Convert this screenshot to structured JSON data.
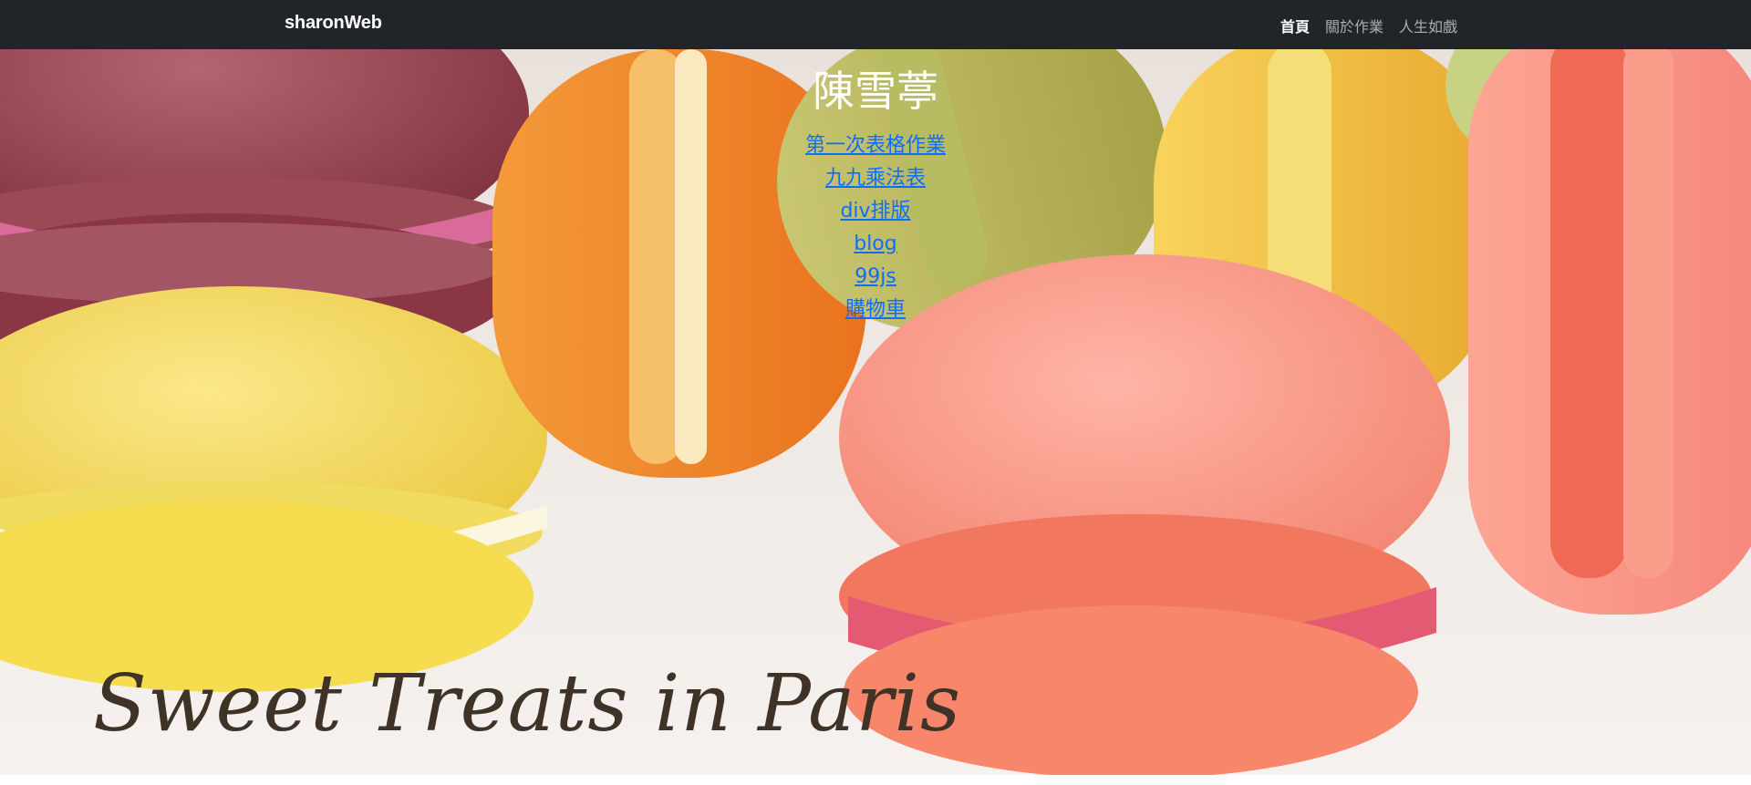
{
  "navbar": {
    "brand": "sharonWeb",
    "links": [
      {
        "label": "首頁",
        "active": true
      },
      {
        "label": "關於作業",
        "active": false
      },
      {
        "label": "人生如戲",
        "active": false
      }
    ]
  },
  "hero": {
    "title": "陳雪葶",
    "links": [
      "第一次表格作業",
      "九九乘法表",
      "div排版",
      "blog",
      "99js",
      "購物車"
    ],
    "image_caption": "Sweet Treats in Paris"
  },
  "colors": {
    "navbar_bg": "#212529",
    "link": "#0d6efd",
    "title": "#ffffff"
  }
}
